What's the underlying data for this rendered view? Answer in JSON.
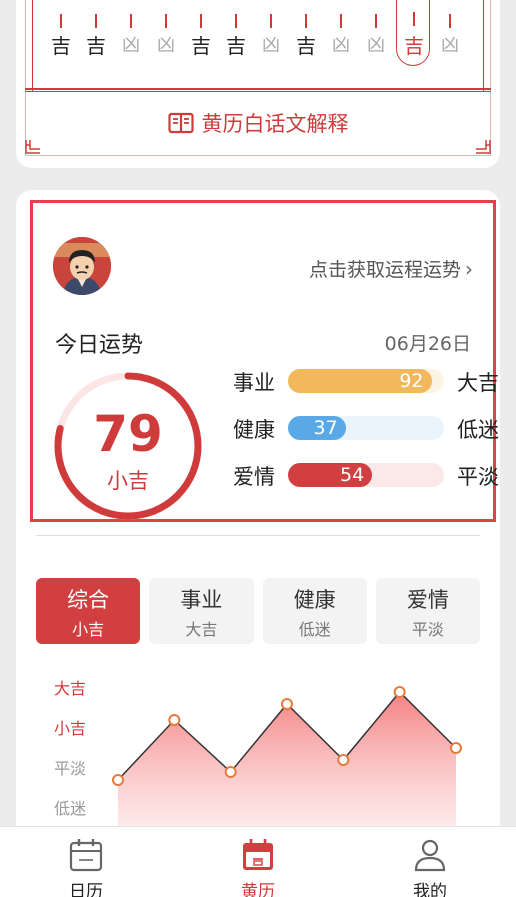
{
  "almanac": {
    "hours": [
      {
        "label": "吉",
        "lucky": true
      },
      {
        "label": "吉",
        "lucky": true
      },
      {
        "label": "凶",
        "lucky": false
      },
      {
        "label": "凶",
        "lucky": false
      },
      {
        "label": "吉",
        "lucky": true
      },
      {
        "label": "吉",
        "lucky": true
      },
      {
        "label": "凶",
        "lucky": false
      },
      {
        "label": "吉",
        "lucky": true
      },
      {
        "label": "凶",
        "lucky": false
      },
      {
        "label": "凶",
        "lucky": false
      },
      {
        "label": "吉",
        "lucky": true,
        "current": true
      },
      {
        "label": "凶",
        "lucky": false
      }
    ],
    "explain_label": "黄历白话文解释"
  },
  "fortune": {
    "link_label": "点击获取运程运势",
    "today_title": "今日运势",
    "date": "06月26日",
    "score": "79",
    "level": "小吉",
    "metrics": [
      {
        "name": "事业",
        "value": "92",
        "percent": 92,
        "level": "大吉",
        "color": "#f2b85b",
        "track": "#fdf3e2"
      },
      {
        "name": "健康",
        "value": "37",
        "percent": 37,
        "level": "低迷",
        "color": "#5aa9e6",
        "track": "#eaf4fd"
      },
      {
        "name": "爱情",
        "value": "54",
        "percent": 54,
        "level": "平淡",
        "color": "#d13f41",
        "track": "#fbe9e9"
      }
    ]
  },
  "tabs": [
    {
      "name": "综合",
      "level": "小吉",
      "active": true
    },
    {
      "name": "事业",
      "level": "大吉",
      "active": false
    },
    {
      "name": "健康",
      "level": "低迷",
      "active": false
    },
    {
      "name": "爱情",
      "level": "平淡",
      "active": false
    }
  ],
  "chart_data": {
    "type": "area",
    "y_levels": [
      "低迷",
      "平淡",
      "小吉",
      "大吉"
    ],
    "level_colors": [
      "#999999",
      "#999999",
      "#cf3b3b",
      "#cf3b3b"
    ],
    "values": [
      0.7,
      2.2,
      0.9,
      2.6,
      1.2,
      2.9,
      1.5
    ],
    "color": "#e5484d"
  },
  "nav": [
    {
      "label": "日历",
      "icon": "calendar-icon",
      "active": false
    },
    {
      "label": "黄历",
      "icon": "almanac-icon",
      "active": true
    },
    {
      "label": "我的",
      "icon": "user-icon",
      "active": false
    }
  ],
  "colors": {
    "accent": "#cf3b3b",
    "highlight_border": "#e0414a"
  }
}
